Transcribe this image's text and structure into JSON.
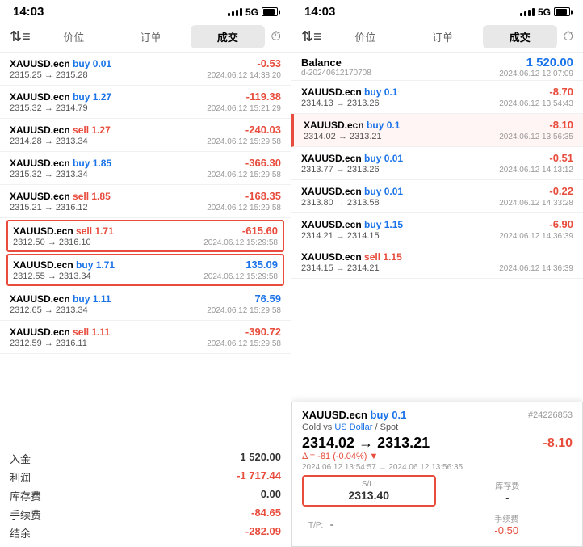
{
  "left": {
    "time": "14:03",
    "signal": "5G",
    "tabs": {
      "sort": "⇅≡",
      "items": [
        "价位",
        "订单",
        "成交"
      ],
      "active": 2,
      "clock": "🕐"
    },
    "trades": [
      {
        "symbol": "XAUUSD.ecn",
        "action": "buy",
        "lot": "0.01",
        "price_from": "2315.25",
        "price_to": "2315.28",
        "date": "2024.06.12 14:38:20",
        "pnl": "-0.53",
        "pnl_type": "negative"
      },
      {
        "symbol": "XAUUSD.ecn",
        "action": "buy",
        "lot": "1.27",
        "price_from": "2315.32",
        "price_to": "2314.79",
        "date": "2024.06.12 15:21:29",
        "pnl": "-119.38",
        "pnl_type": "negative"
      },
      {
        "symbol": "XAUUSD.ecn",
        "action": "sell",
        "lot": "1.27",
        "price_from": "2314.28",
        "price_to": "2313.34",
        "date": "2024.06.12 15:29:58",
        "pnl": "-240.03",
        "pnl_type": "negative"
      },
      {
        "symbol": "XAUUSD.ecn",
        "action": "buy",
        "lot": "1.85",
        "price_from": "2315.32",
        "price_to": "2313.34",
        "date": "2024.06.12 15:29:58",
        "pnl": "-366.30",
        "pnl_type": "negative"
      },
      {
        "symbol": "XAUUSD.ecn",
        "action": "sell",
        "lot": "1.85",
        "price_from": "2315.21",
        "price_to": "2316.12",
        "date": "2024.06.12 15:29:58",
        "pnl": "-168.35",
        "pnl_type": "negative"
      },
      {
        "symbol": "XAUUSD.ecn",
        "action": "sell",
        "lot": "1.71",
        "price_from": "2312.50",
        "price_to": "2316.10",
        "date": "2024.06.12 15:29:58",
        "pnl": "-615.60",
        "pnl_type": "negative",
        "highlight": true
      },
      {
        "symbol": "XAUUSD.ecn",
        "action": "buy",
        "lot": "1.71",
        "price_from": "2312.55",
        "price_to": "2313.34",
        "date": "2024.06.12 15:29:58",
        "pnl": "135.09",
        "pnl_type": "positive",
        "highlight": true
      },
      {
        "symbol": "XAUUSD.ecn",
        "action": "buy",
        "lot": "1.11",
        "price_from": "2312.65",
        "price_to": "2313.34",
        "date": "2024.06.12 15:29:58",
        "pnl": "76.59",
        "pnl_type": "positive"
      },
      {
        "symbol": "XAUUSD.ecn",
        "action": "sell",
        "lot": "1.11",
        "price_from": "2312.59",
        "price_to": "2316.11",
        "date": "2024.06.12 15:29:58",
        "pnl": "-390.72",
        "pnl_type": "negative"
      }
    ],
    "summary": [
      {
        "label": "入金",
        "value": "1 520.00",
        "type": "normal"
      },
      {
        "label": "利润",
        "value": "-1 717.44",
        "type": "red"
      },
      {
        "label": "库存费",
        "value": "0.00",
        "type": "normal"
      },
      {
        "label": "手续费",
        "value": "-84.65",
        "type": "red"
      },
      {
        "label": "结余",
        "value": "-282.09",
        "type": "red"
      }
    ]
  },
  "right": {
    "time": "14:03",
    "signal": "5G",
    "tabs": {
      "sort": "⇅≡",
      "items": [
        "价位",
        "订单",
        "成交"
      ],
      "active": 2,
      "clock": "🕐"
    },
    "balance": {
      "label": "Balance",
      "account": "d-20240612170708",
      "date": "2024.06.12 12:07:09",
      "value": "1 520.00"
    },
    "trades": [
      {
        "symbol": "XAUUSD.ecn",
        "action": "buy",
        "lot": "0.1",
        "price_from": "2314.13",
        "price_to": "2313.26",
        "date": "2024.06.12 13:54:43",
        "pnl": "-8.70",
        "pnl_type": "negative"
      },
      {
        "symbol": "XAUUSD.ecn",
        "action": "buy",
        "lot": "0.1",
        "price_from": "2314.02",
        "price_to": "2313.21",
        "date": "2024.06.12 13:56:35",
        "pnl": "-8.10",
        "pnl_type": "negative",
        "highlight": true
      },
      {
        "symbol": "XAUUSD.ecn",
        "action": "buy",
        "lot": "0.01",
        "price_from": "2313.77",
        "price_to": "2313.26",
        "date": "2024.06.12 14:13:12",
        "pnl": "-0.51",
        "pnl_type": "negative"
      },
      {
        "symbol": "XAUUSD.ecn",
        "action": "buy",
        "lot": "0.01",
        "price_from": "2313.80",
        "price_to": "2313.58",
        "date": "2024.06.12 14:33:28",
        "pnl": "-0.22",
        "pnl_type": "negative"
      },
      {
        "symbol": "XAUUSD.ecn",
        "action": "buy",
        "lot": "1.15",
        "price_from": "2314.21",
        "price_to": "2314.15",
        "date": "2024.06.12 14:36:39",
        "pnl": "-6.90",
        "pnl_type": "negative"
      },
      {
        "symbol": "XAUUSD.ecn",
        "action": "sell",
        "lot": "1.15",
        "price_from": "2314.15",
        "price_to": "2314.21",
        "date": "2024.06.12 14:36:39",
        "pnl": "",
        "pnl_type": "normal"
      }
    ],
    "detail": {
      "symbol": "XAUUSD.ecn",
      "action": "buy",
      "lot": "0.1",
      "id": "#24226853",
      "subtitle": "Gold vs US Dollar / Spot",
      "price_from": "2314.02",
      "price_to": "2313.21",
      "delta": "Δ = -81 (-0.04%)",
      "time_from": "2024.06.12 13:54:57",
      "time_to": "2024.06.12 13:56:35",
      "pnl": "-8.10",
      "sl": {
        "label": "S/L:",
        "value": "2313.40"
      },
      "tp": {
        "label": "T/P:",
        "value": "-"
      },
      "storage": {
        "label": "库存费",
        "value": "-"
      },
      "commission": {
        "label": "手续费",
        "value": "-0.50"
      }
    }
  }
}
